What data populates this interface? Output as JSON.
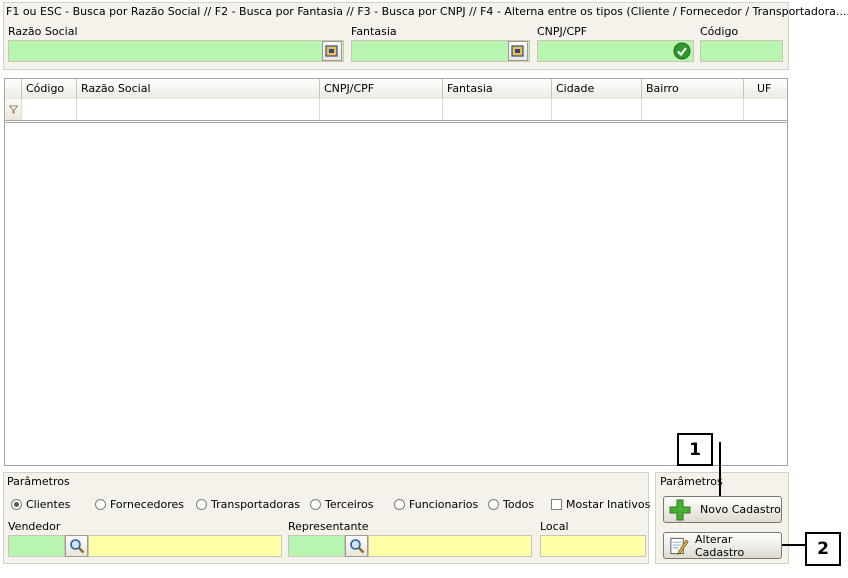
{
  "search": {
    "hint": "F1 ou ESC - Busca por Razão Social // F2 - Busca por Fantasia // F3 - Busca por CNPJ // F4 - Alterna entre os tipos (Cliente / Fornecedor / Transportadora....)",
    "razao_social_label": "Razão Social",
    "fantasia_label": "Fantasia",
    "cnpj_label": "CNPJ/CPF",
    "codigo_label": "Código"
  },
  "grid": {
    "columns": [
      "Código",
      "Razão Social",
      "CNPJ/CPF",
      "Fantasia",
      "Cidade",
      "Bairro",
      "UF"
    ]
  },
  "params": {
    "title": "Parâmetros",
    "radios": [
      "Clientes",
      "Fornecedores",
      "Transportadoras",
      "Terceiros",
      "Funcionarios",
      "Todos"
    ],
    "selected": "Clientes",
    "checkbox_label": "Mostar Inativos",
    "vendedor_label": "Vendedor",
    "representante_label": "Representante",
    "local_label": "Local"
  },
  "actions": {
    "title": "Parâmetros",
    "novo_label": "Novo Cadastro",
    "alterar_label": "Alterar Cadastro"
  },
  "callouts": [
    "1",
    "2"
  ],
  "colors": {
    "field_green": "#b8f5b0",
    "field_yellow": "#ffffa8",
    "panel": "#f4f2ea"
  }
}
